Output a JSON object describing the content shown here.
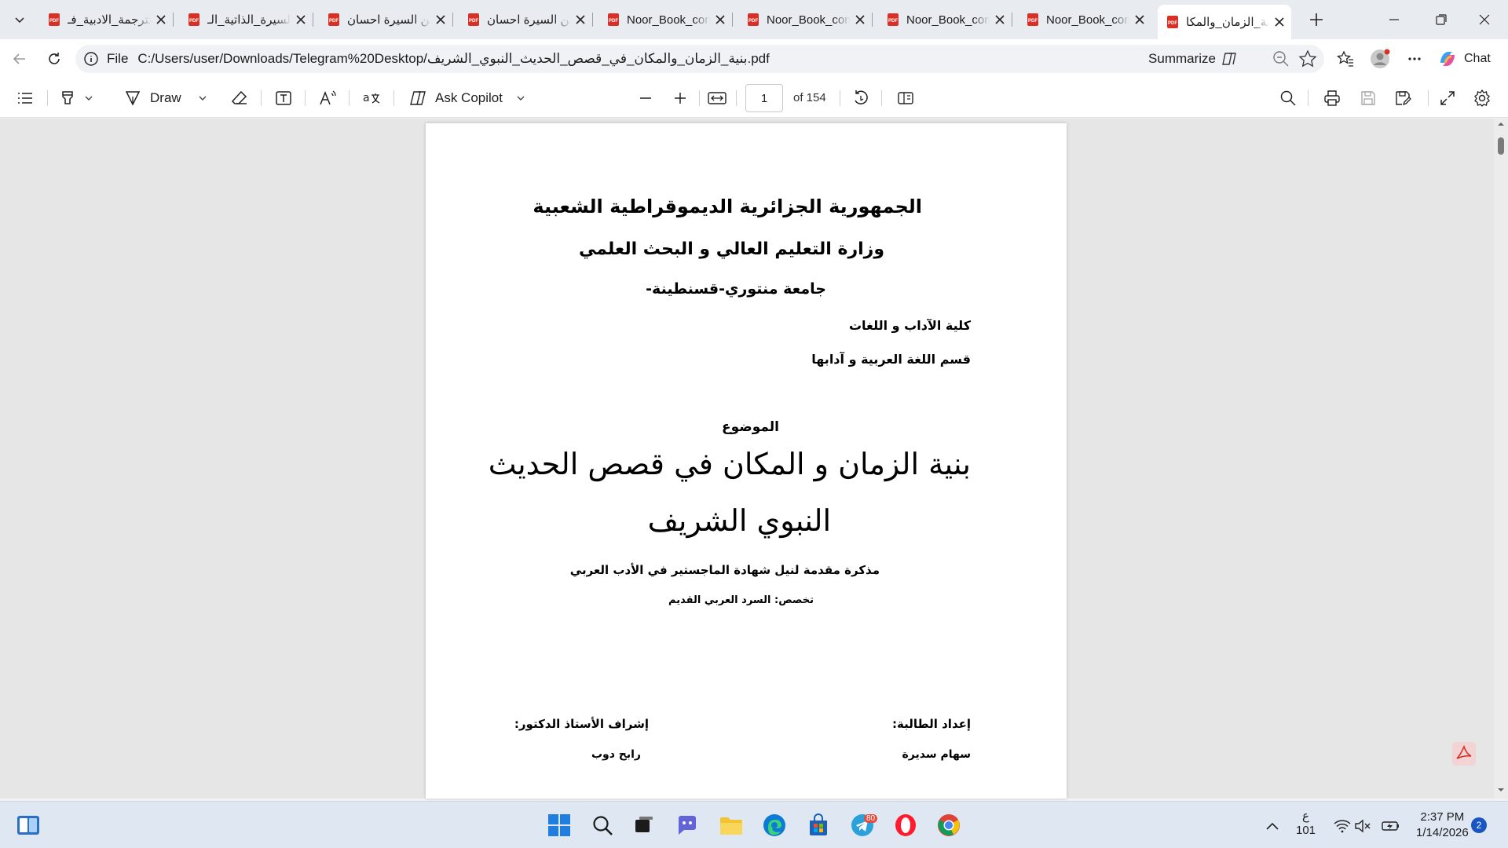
{
  "tabs": [
    {
      "title": "الترجمة_الادبية_فـ"
    },
    {
      "title": "السيرة_الذاتية_الـ"
    },
    {
      "title": "فن السيرة احسان"
    },
    {
      "title": "فن السيرة احسان"
    },
    {
      "title": "Noor_Book_com"
    },
    {
      "title": "Noor_Book_com"
    },
    {
      "title": "Noor_Book_com"
    },
    {
      "title": "Noor_Book_com"
    },
    {
      "title": "بنية_الزمان_والمكا"
    }
  ],
  "address": {
    "scheme_label": "File",
    "url": "C:/Users/user/Downloads/Telegram%20Desktop/بنية_الزمان_والمكان_في_قصص_الحديث_النبوي_الشريف.pdf",
    "summarize_label": "Summarize",
    "chat_label": "Chat"
  },
  "pdf_toolbar": {
    "draw_label": "Draw",
    "copilot_label": "Ask Copilot",
    "page_current": "1",
    "page_total_label": "of 154"
  },
  "document": {
    "line1": "الجمهورية الجزائرية الديموقراطية الشعبية",
    "line2": "وزارة التعليم العالي و البحث العلمي",
    "line3": "جامعة منتوري-قسنطينة-",
    "faculty": "كلية الآداب و اللغات",
    "department": "قسم اللغة العربية و آدابها",
    "subject_label": "الموضوع",
    "title_line1": "بنية الزمان و المكان في قصص الحديث",
    "title_line2": "النبوي الشريف",
    "thesis": "مذكرة مقدمة لنيل شهادة الماجستير في الأدب العربي",
    "specialty": "تخصص: السرد العربي القديم",
    "student_label": "إعداد الطالبة:",
    "student_name": "سهام سديرة",
    "supervisor_label": "إشراف الأستاذ الدكتور:",
    "supervisor_name": "رابح دوب"
  },
  "taskbar": {
    "telegram_badge": "80",
    "lang_line1": "ع",
    "lang_line2": "101",
    "time": "2:37 PM",
    "date": "1/14/2026",
    "notifications": "2"
  },
  "colors": {
    "pdf_red": "#d93025",
    "edge_blue": "#0c7bd6",
    "accent": "#1a55c4"
  }
}
